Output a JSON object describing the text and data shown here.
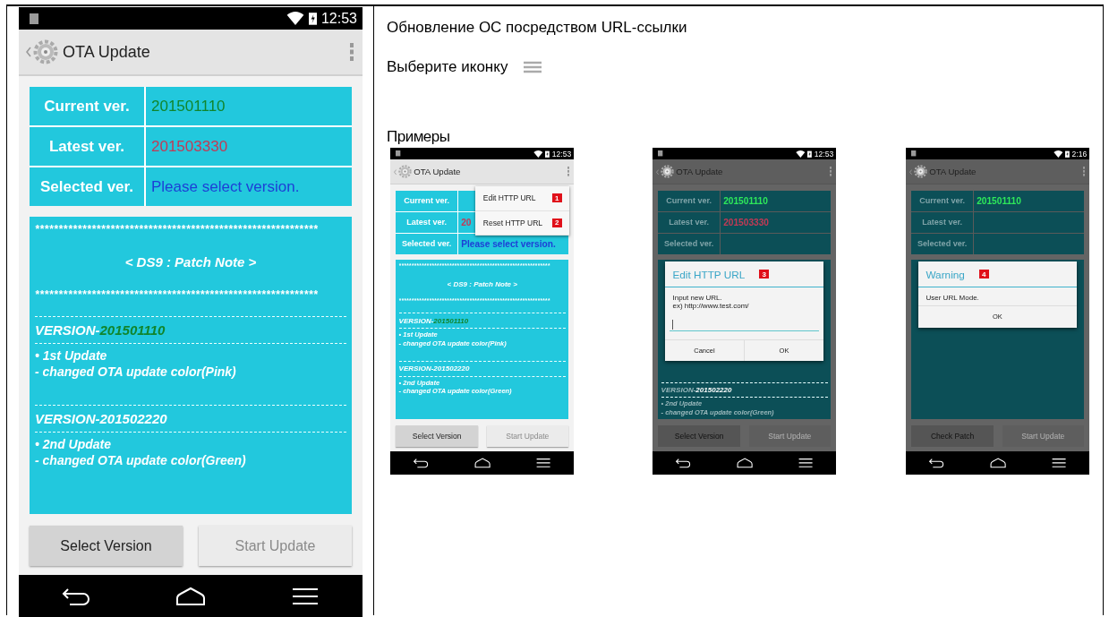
{
  "main_phone": {
    "status_time": "12:53",
    "app_title": "OTA Update",
    "dimmed": false,
    "info_rows": [
      {
        "label": "Current ver.",
        "value": "201501110",
        "color": "#11852c"
      },
      {
        "label": "Latest ver.",
        "value": "201503330",
        "color": "#c23a55"
      },
      {
        "label": "Selected ver.",
        "value": "Please select version.",
        "color": "#1d3fd6"
      }
    ],
    "patch_note": {
      "stars_top": "************************************************************",
      "title": "< DS9 : Patch Note >",
      "stars_bottom": "************************************************************",
      "entries": [
        {
          "version_prefix": "VERSION-",
          "version": "201501110",
          "color": "#11852c",
          "update": "• 1st Update",
          "change": "- changed OTA update color(Pink)"
        },
        {
          "version_prefix": "VERSION-",
          "version": "201502220",
          "color": "#ffffff",
          "update": "• 2nd Update",
          "change": "- changed OTA update color(Green)"
        }
      ]
    },
    "buttons": [
      {
        "label": "Select Version",
        "disabled": false
      },
      {
        "label": "Start Update",
        "disabled": true
      }
    ]
  },
  "description": {
    "title": "Обновление ОС посредством URL-ссылки",
    "prompt": "Выберите иконку"
  },
  "examples": {
    "heading": "Примеры",
    "screens": [
      {
        "status_time": "12:53",
        "app_title": "OTA Update",
        "dimmed": false,
        "info_rows": [
          {
            "label": "Current ver."
          },
          {
            "label": "Latest ver.",
            "value": "20",
            "color": "#c23a55"
          },
          {
            "label": "Selected ver.",
            "value": "Please select version.",
            "color": "#1d3fd6"
          }
        ],
        "patch_note": {
          "stars_top": "************************************************************",
          "title": "< DS9 : Patch Note >",
          "stars_bottom": "************************************************************",
          "entries": [
            {
              "version_prefix": "VERSION-",
              "version": "201501110",
              "color": "#11852c",
              "update": "• 1st Update",
              "change": "- changed OTA update color(Pink)"
            },
            {
              "version_prefix": "VERSION-",
              "version": "201502220",
              "color": "#ffffff",
              "update": "• 2nd Update",
              "change": "- changed OTA update color(Green)"
            }
          ]
        },
        "buttons": [
          {
            "label": "Select Version",
            "disabled": false
          },
          {
            "label": "Start Update",
            "disabled": true
          }
        ],
        "menu": [
          {
            "label": "Edit HTTP URL",
            "badge": "1"
          },
          {
            "label": "Reset HTTP URL",
            "badge": "2"
          }
        ]
      },
      {
        "status_time": "12:53",
        "app_title": "OTA Update",
        "dimmed": true,
        "info_rows": [
          {
            "label": "Current ver.",
            "value": "201501110",
            "color": "#2ee85a"
          },
          {
            "label": "Latest ver.",
            "value": "201503330",
            "color": "#c23a55"
          },
          {
            "label": "Selected ver."
          }
        ],
        "patch_note": {
          "entries": [
            {
              "version_prefix": "VERSION-",
              "version": "201502220",
              "color": "#ffffff",
              "update": "• 2nd Update",
              "change": "- changed OTA update color(Green)"
            }
          ]
        },
        "buttons": [
          {
            "label": "Select Version",
            "disabled": false
          },
          {
            "label": "Start Update",
            "disabled": true
          }
        ],
        "dialog": {
          "title": "Edit HTTP URL",
          "badge": "3",
          "message_lines": [
            "Input new URL.",
            "ex) http://www.test.com/"
          ],
          "has_input": true,
          "buttons": [
            "Cancel",
            "OK"
          ]
        }
      },
      {
        "status_time": "2:16",
        "app_title": "OTA Update",
        "dimmed": true,
        "info_rows": [
          {
            "label": "Current ver.",
            "value": "201501110",
            "color": "#2ee85a"
          },
          {
            "label": "Latest ver."
          },
          {
            "label": "Selected ver."
          }
        ],
        "buttons": [
          {
            "label": "Check Patch",
            "disabled": false
          },
          {
            "label": "Start Update",
            "disabled": true
          }
        ],
        "dialog": {
          "title": "Warning",
          "badge": "4",
          "message_lines": [
            "User URL Mode."
          ],
          "has_input": false,
          "buttons": [
            "OK"
          ]
        }
      }
    ]
  }
}
